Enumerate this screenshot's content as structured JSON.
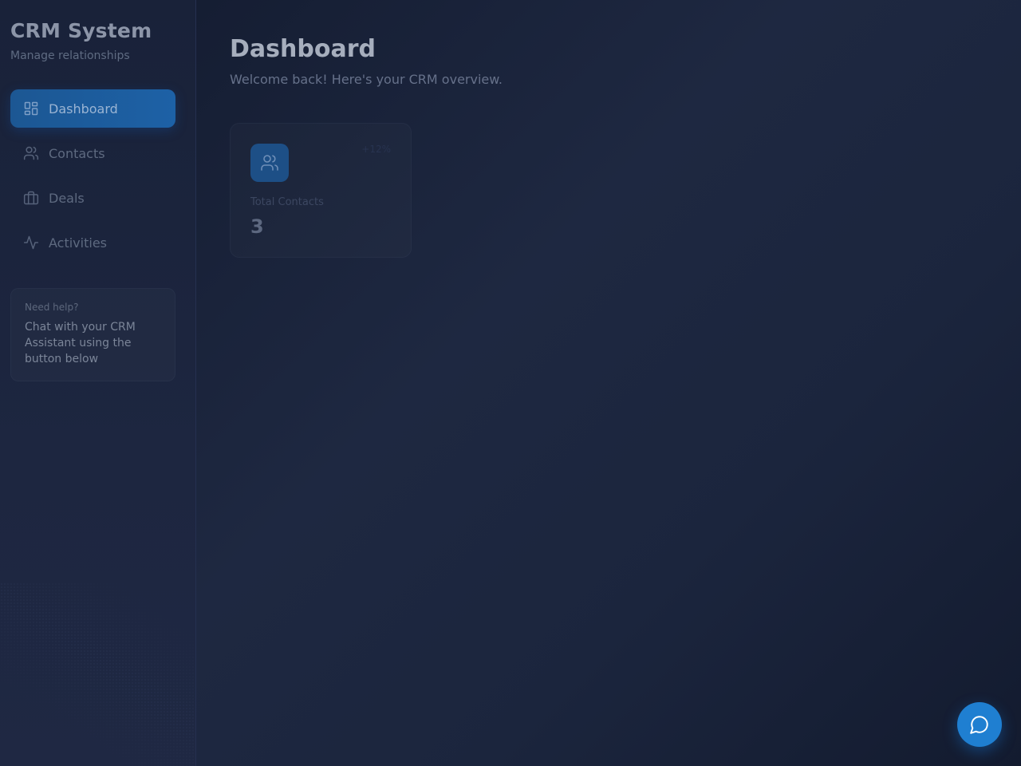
{
  "sidebar": {
    "title": "CRM System",
    "subtitle": "Manage relationships",
    "items": [
      {
        "label": "Dashboard",
        "icon": "layout-grid-icon",
        "active": true
      },
      {
        "label": "Contacts",
        "icon": "users-icon",
        "active": false
      },
      {
        "label": "Deals",
        "icon": "briefcase-icon",
        "active": false
      },
      {
        "label": "Activities",
        "icon": "activity-icon",
        "active": false
      }
    ],
    "help": {
      "title": "Need help?",
      "text": "Chat with your CRM Assistant using the button below"
    }
  },
  "main": {
    "title": "Dashboard",
    "subtitle": "Welcome back! Here's your CRM overview.",
    "stats": [
      {
        "label": "Total Contacts",
        "value": "3",
        "trend": "+12%",
        "icon": "users-icon"
      }
    ]
  },
  "chat_button": {
    "icon": "chat-bubble-icon"
  },
  "colors": {
    "accent": "#1f7fd1",
    "active_nav": "#1d61a6",
    "background": "#1a2236"
  }
}
